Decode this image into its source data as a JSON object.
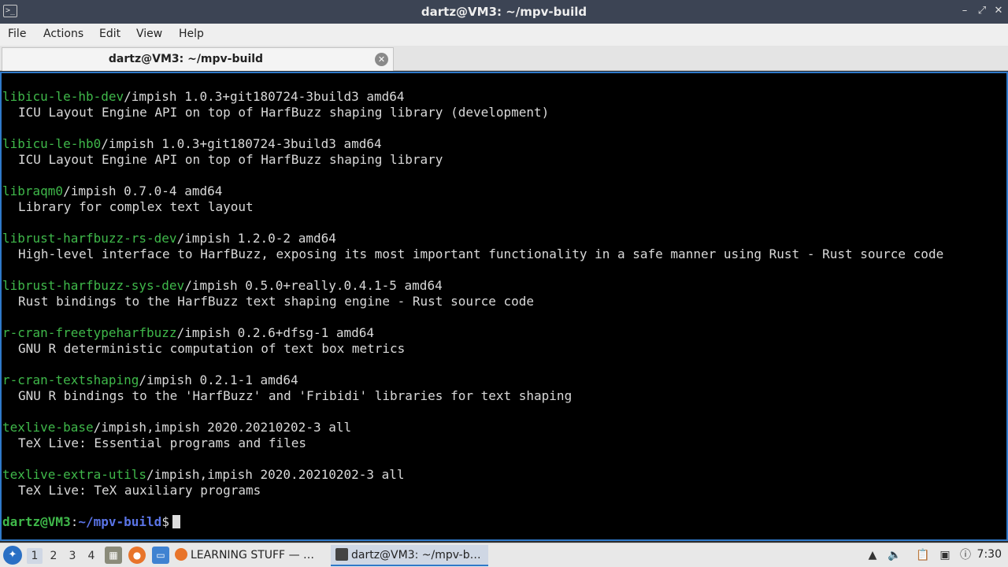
{
  "window": {
    "title": "dartz@VM3: ~/mpv-build",
    "app_icon": "terminal-icon",
    "controls": {
      "minimize": "minimize-icon",
      "restore": "restore-icon",
      "close": "close-icon"
    }
  },
  "menu": [
    "File",
    "Actions",
    "Edit",
    "View",
    "Help"
  ],
  "tab": {
    "label": "dartz@VM3: ~/mpv-build",
    "close_icon": "close-icon"
  },
  "terminal": {
    "entries": [
      {
        "pkg": "libicu-le-hb-dev",
        "rest": "/impish 1.0.3+git180724-3build3 amd64",
        "desc": "ICU Layout Engine API on top of HarfBuzz shaping library (development)"
      },
      {
        "pkg": "libicu-le-hb0",
        "rest": "/impish 1.0.3+git180724-3build3 amd64",
        "desc": "ICU Layout Engine API on top of HarfBuzz shaping library"
      },
      {
        "pkg": "libraqm0",
        "rest": "/impish 0.7.0-4 amd64",
        "desc": "Library for complex text layout"
      },
      {
        "pkg": "librust-harfbuzz-rs-dev",
        "rest": "/impish 1.2.0-2 amd64",
        "desc": "High-level interface to HarfBuzz, exposing its most important functionality in a safe manner using Rust - Rust source code"
      },
      {
        "pkg": "librust-harfbuzz-sys-dev",
        "rest": "/impish 0.5.0+really.0.4.1-5 amd64",
        "desc": "Rust bindings to the HarfBuzz text shaping engine - Rust source code"
      },
      {
        "pkg": "r-cran-freetypeharfbuzz",
        "rest": "/impish 0.2.6+dfsg-1 amd64",
        "desc": "GNU R deterministic computation of text box metrics"
      },
      {
        "pkg": "r-cran-textshaping",
        "rest": "/impish 0.2.1-1 amd64",
        "desc": "GNU R bindings to the 'HarfBuzz' and 'Fribidi' libraries for text shaping"
      },
      {
        "pkg": "texlive-base",
        "rest": "/impish,impish 2020.20210202-3 all",
        "desc": "TeX Live: Essential programs and files"
      },
      {
        "pkg": "texlive-extra-utils",
        "rest": "/impish,impish 2020.20210202-3 all",
        "desc": "TeX Live: TeX auxiliary programs"
      }
    ],
    "prompt": {
      "user_host": "dartz@VM3",
      "separator": ":",
      "path": "~/mpv-build",
      "symbol": "$"
    }
  },
  "taskbar": {
    "start_icon": "start-menu-icon",
    "workspaces": [
      "1",
      "2",
      "3",
      "4"
    ],
    "active_workspace": "1",
    "launchers": [
      "file-manager-icon",
      "firefox-icon",
      "show-desktop-icon"
    ],
    "tasks": [
      {
        "label": "LEARNING STUFF — …",
        "icon": "firefox-icon",
        "active": false
      },
      {
        "label": "dartz@VM3: ~/mpv-b…",
        "icon": "terminal-icon",
        "active": true
      }
    ],
    "tray": [
      "update-icon",
      "volume-icon",
      "clipboard-icon",
      "network-icon",
      "notification-icon"
    ],
    "clock": "7:30"
  },
  "colors": {
    "accent": "#2f79c9",
    "package_name": "#3fb84a",
    "prompt_path": "#5a74e6",
    "terminal_bg": "#000000"
  }
}
